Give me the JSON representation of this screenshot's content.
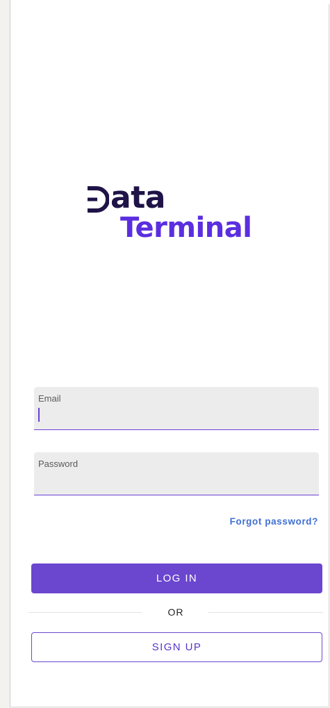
{
  "logo": {
    "line1": "ata",
    "line2": "Terminal",
    "colors": {
      "dark": "#1f1347",
      "accent": "#5b2ee0"
    }
  },
  "form": {
    "email": {
      "label": "Email",
      "value": ""
    },
    "password": {
      "label": "Password",
      "value": ""
    },
    "forgot_label": "Forgot password?"
  },
  "actions": {
    "login_label": "LOG IN",
    "divider_label": "OR",
    "signup_label": "SIGN UP"
  },
  "colors": {
    "primary": "#6b46cf",
    "link": "#3f6fd1",
    "field_bg": "#ececec"
  }
}
